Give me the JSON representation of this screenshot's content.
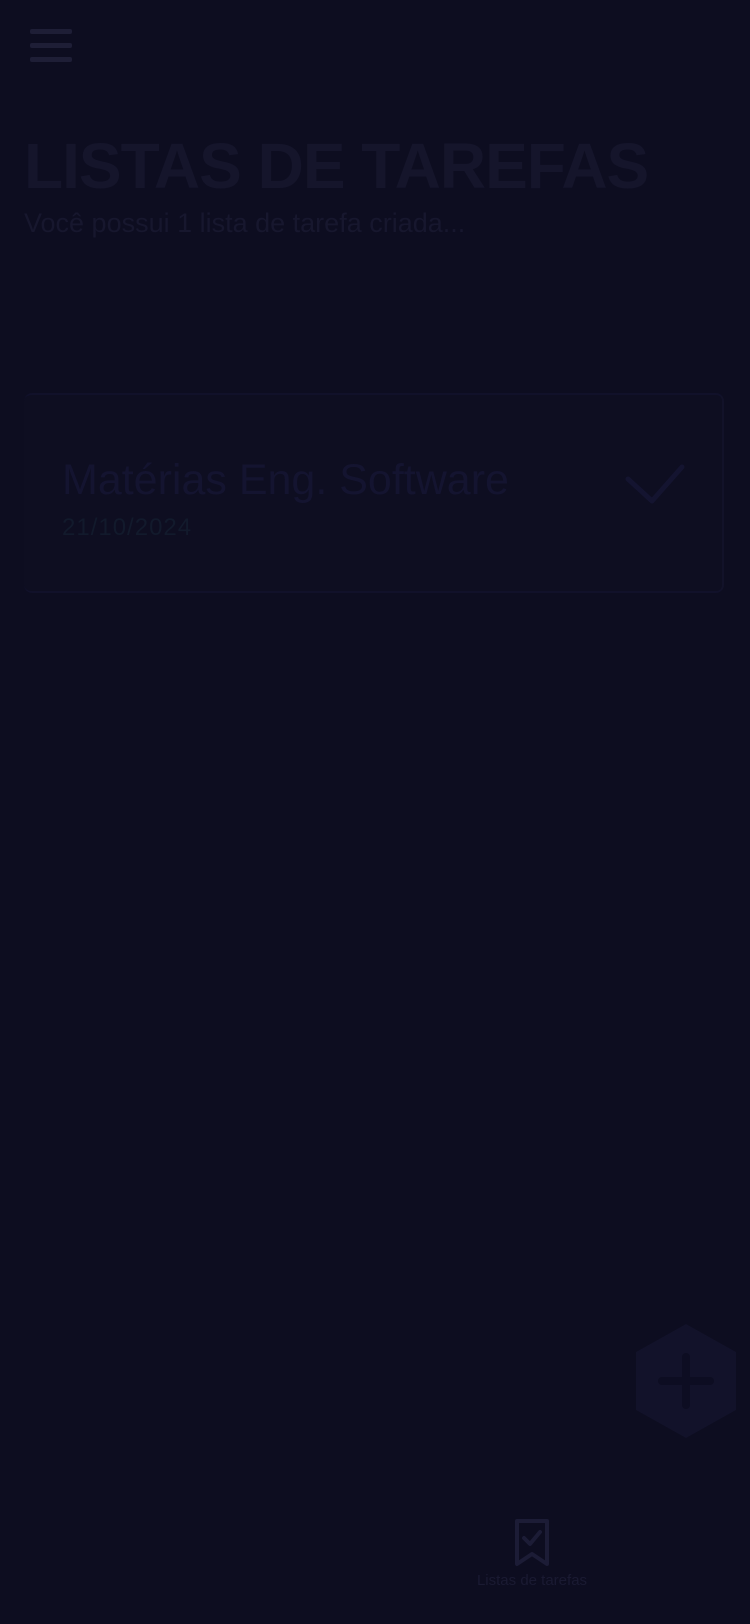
{
  "header": {
    "title": "LISTAS DE TAREFAS",
    "subtitle": "Você possui 1 lista de tarefa criada..."
  },
  "lists": [
    {
      "name": "Matérias Eng. Software",
      "date": "21/10/2024",
      "completed": true
    }
  ],
  "bottom_nav": {
    "items": [
      {
        "label": "Listas de tarefas",
        "icon": "bookmark-check-icon"
      }
    ]
  },
  "icons": {
    "menu": "hamburger-menu-icon",
    "check": "check-icon",
    "add": "plus-icon"
  },
  "colors": {
    "background": "#0d0d20",
    "card": "#0e0e21",
    "text": "#15152b"
  }
}
